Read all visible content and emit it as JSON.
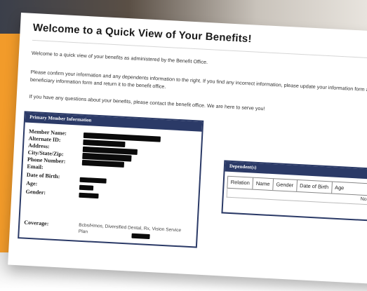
{
  "page": {
    "title": "Welcome to a Quick View of Your Benefits!",
    "intro": "Welcome to a quick view of your benefits as administered by the Benefit Office.",
    "confirm": "Please confirm your information and any dependents information to the right. If you find any incorrect information, please update your information form and/or the beneficiary information form and return it to the benefit office.",
    "questions": "If you have any questions about your benefits, please contact the benefit office. We are here to serve you!"
  },
  "primary_panel": {
    "header": "Primary Member Information",
    "labels": {
      "member_name": "Member Name:",
      "alternate_id": "Alternate ID:",
      "address": "Address:",
      "city_state_zip": "City/State/Zip:",
      "phone": "Phone Number:",
      "email": "Email:",
      "dob": "Date of Birth:",
      "age": "Age:",
      "gender": "Gender:",
      "coverage": "Coverage:"
    },
    "coverage_value": "Bcbs/Hmos, Diversified Dental, Rx, Vision Service Plan"
  },
  "dependents_panel": {
    "header": "Dependent(s)",
    "columns": [
      "Relation",
      "Name",
      "Gender",
      "Date of Birth",
      "Age"
    ],
    "empty_text": "No data to display"
  },
  "colors": {
    "accent": "#2b3a67",
    "background": "#f29b2a"
  }
}
